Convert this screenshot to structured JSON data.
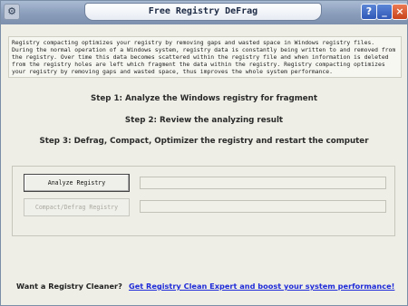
{
  "window": {
    "title": "Free Registry DeFrag",
    "buttons": {
      "help": "?",
      "minimize": "_",
      "close": "×"
    }
  },
  "description": {
    "lines": [
      "Registry compacting optimizes your registry by removing gaps and wasted space in Windows registry files.",
      "During the normal operation of a Windows system, registry data is constantly being written to and removed from",
      "the registry. Over time this data becomes scattered within the registry file and when information is deleted",
      "from the registry holes are left which fragment the data within the registry. Registry compacting optimizes",
      "your registry by removing gaps and wasted space, thus improves the whole system performance."
    ]
  },
  "steps": [
    "Step 1: Analyze the Windows registry for fragment",
    "Step 2: Review the analyzing result",
    "Step 3: Defrag, Compact, Optimizer the registry and restart the computer"
  ],
  "actions": {
    "analyze_label": "Analyze Registry",
    "compact_label": "Compact/Defrag Registry"
  },
  "footer": {
    "prompt": "Want a Registry Cleaner?",
    "link": "Get Registry Clean Expert and boost your system performance!"
  },
  "colors": {
    "title_bar": "#8a9dba",
    "close_button": "#c9431c",
    "link": "#1f2bd8",
    "window_background": "#eeeee6"
  }
}
